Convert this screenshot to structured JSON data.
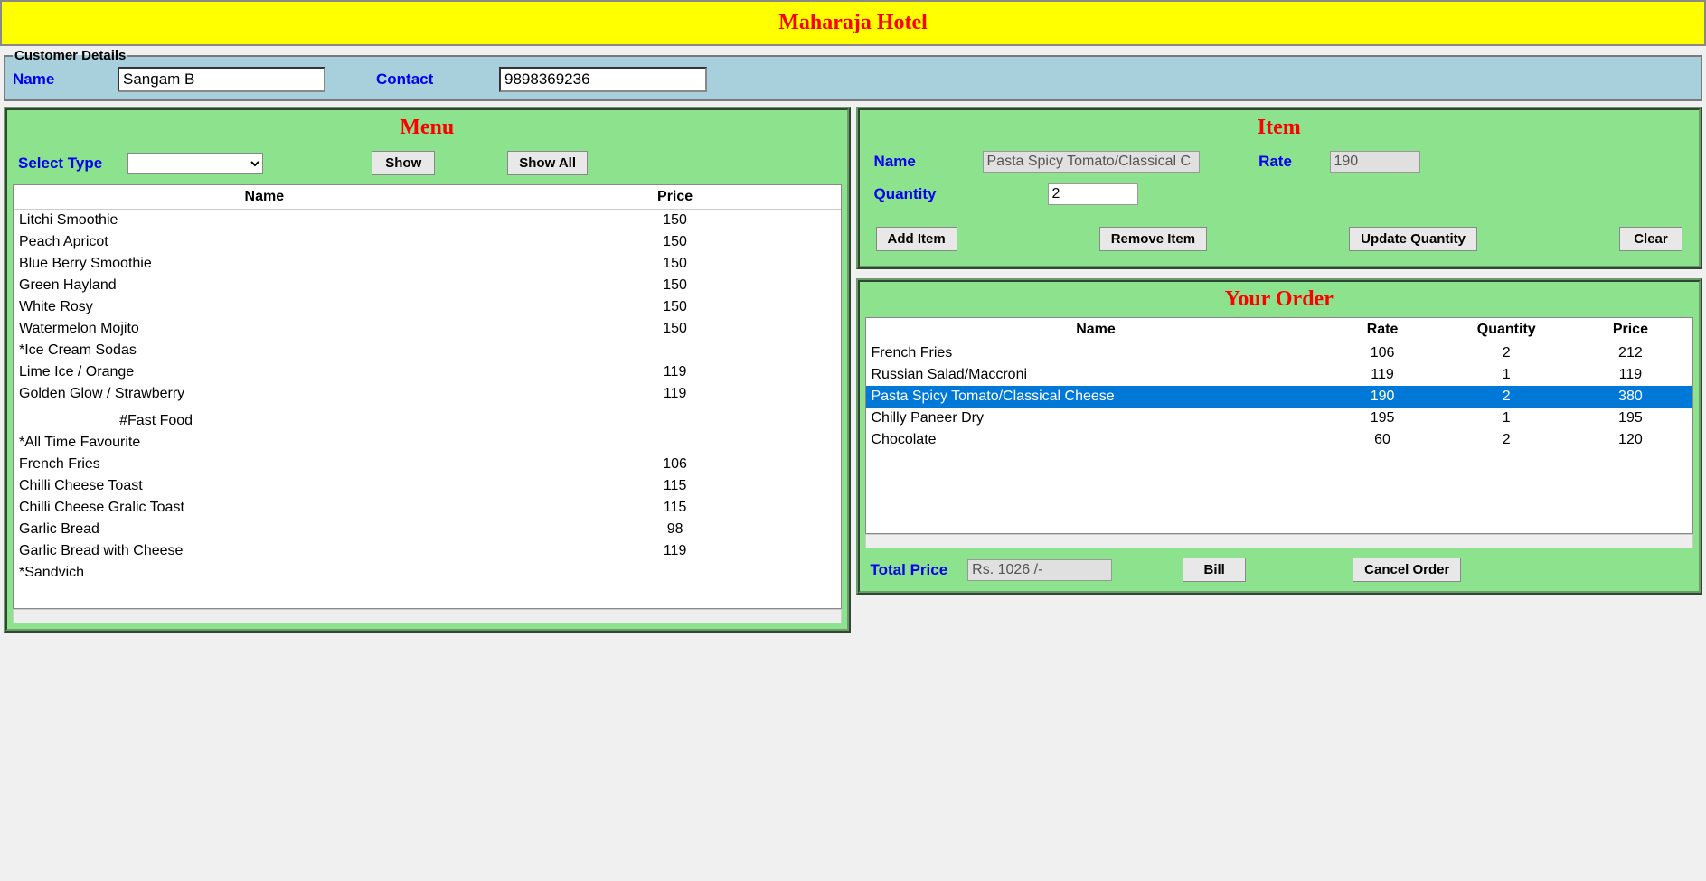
{
  "header": {
    "title": "Maharaja Hotel"
  },
  "customer": {
    "legend": "Customer Details",
    "name_label": "Name",
    "name_value": "Sangam B",
    "contact_label": "Contact",
    "contact_value": "9898369236"
  },
  "menu": {
    "title": "Menu",
    "select_type_label": "Select Type",
    "select_type_value": "",
    "show_label": "Show",
    "show_all_label": "Show All",
    "columns": {
      "name": "Name",
      "price": "Price"
    },
    "items": [
      {
        "name": "Litchi Smoothie",
        "price": "150"
      },
      {
        "name": "Peach Apricot",
        "price": "150"
      },
      {
        "name": "Blue Berry Smoothie",
        "price": "150"
      },
      {
        "name": "Green Hayland",
        "price": "150"
      },
      {
        "name": "White Rosy",
        "price": "150"
      },
      {
        "name": "Watermelon Mojito",
        "price": "150"
      },
      {
        "name": "*Ice Cream Sodas",
        "price": ""
      },
      {
        "name": "Lime Ice / Orange",
        "price": "119"
      },
      {
        "name": "Golden Glow / Strawberry",
        "price": "119"
      },
      {
        "name": "",
        "price": ""
      },
      {
        "name": "                         #Fast Food",
        "price": "",
        "indent": true
      },
      {
        "name": "*All Time Favourite",
        "price": ""
      },
      {
        "name": "French Fries",
        "price": "106"
      },
      {
        "name": "Chilli Cheese Toast",
        "price": "115"
      },
      {
        "name": "Chilli Cheese Gralic Toast",
        "price": "115"
      },
      {
        "name": "Garlic Bread",
        "price": "98"
      },
      {
        "name": "Garlic Bread with Cheese",
        "price": "119"
      },
      {
        "name": "*Sandvich",
        "price": ""
      }
    ]
  },
  "item": {
    "title": "Item",
    "name_label": "Name",
    "name_value": "Pasta Spicy Tomato/Classical C",
    "rate_label": "Rate",
    "rate_value": "190",
    "quantity_label": "Quantity",
    "quantity_value": "2",
    "add_label": "Add Item",
    "remove_label": "Remove Item",
    "update_label": "Update Quantity",
    "clear_label": "Clear"
  },
  "order": {
    "title": "Your Order",
    "columns": {
      "name": "Name",
      "rate": "Rate",
      "quantity": "Quantity",
      "price": "Price"
    },
    "items": [
      {
        "name": "French Fries",
        "rate": "106",
        "quantity": "2",
        "price": "212",
        "selected": false
      },
      {
        "name": "Russian Salad/Maccroni",
        "rate": "119",
        "quantity": "1",
        "price": "119",
        "selected": false
      },
      {
        "name": "Pasta Spicy Tomato/Classical Cheese",
        "rate": "190",
        "quantity": "2",
        "price": "380",
        "selected": true
      },
      {
        "name": "Chilly Paneer Dry",
        "rate": "195",
        "quantity": "1",
        "price": "195",
        "selected": false
      },
      {
        "name": "Chocolate",
        "rate": "60",
        "quantity": "2",
        "price": "120",
        "selected": false
      }
    ],
    "total_label": "Total Price",
    "total_value": "Rs. 1026  /-",
    "bill_label": "Bill",
    "cancel_label": "Cancel Order"
  }
}
